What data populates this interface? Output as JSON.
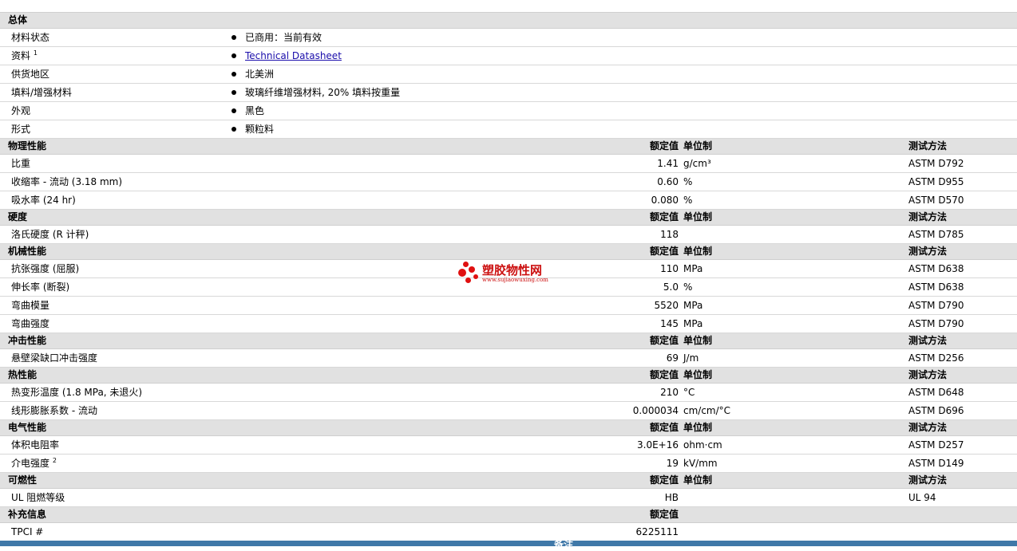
{
  "general": {
    "title": "总体",
    "rows": [
      {
        "label": "材料状态",
        "sup": "",
        "value": "已商用：当前有效",
        "link": false
      },
      {
        "label": "资料",
        "sup": "1",
        "value": "Technical Datasheet",
        "link": true
      },
      {
        "label": "供货地区",
        "sup": "",
        "value": "北美洲",
        "link": false
      },
      {
        "label": "填料/增强材料",
        "sup": "",
        "value": "玻璃纤维增强材料, 20% 填料按重量",
        "link": false
      },
      {
        "label": "外观",
        "sup": "",
        "value": "黑色",
        "link": false
      },
      {
        "label": "形式",
        "sup": "",
        "value": "颗粒料",
        "link": false
      }
    ]
  },
  "headers": {
    "nominal": "额定值",
    "unit": "单位制",
    "method": "测试方法"
  },
  "sections": [
    {
      "title": "物理性能",
      "rows": [
        {
          "label": "比重",
          "sup": "",
          "nominal": "1.41",
          "unit": "g/cm³",
          "method": "ASTM D792"
        },
        {
          "label": "收缩率  - 流动  (3.18 mm)",
          "sup": "",
          "nominal": "0.60",
          "unit": "%",
          "method": "ASTM D955"
        },
        {
          "label": "吸水率  (24 hr)",
          "sup": "",
          "nominal": "0.080",
          "unit": "%",
          "method": "ASTM D570"
        }
      ]
    },
    {
      "title": "硬度",
      "rows": [
        {
          "label": "洛氏硬度  (R 计秤)",
          "sup": "",
          "nominal": "118",
          "unit": "",
          "method": "ASTM D785"
        }
      ]
    },
    {
      "title": "机械性能",
      "rows": [
        {
          "label": "抗张强度  (屈服)",
          "sup": "",
          "nominal": "110",
          "unit": "MPa",
          "method": "ASTM D638"
        },
        {
          "label": "伸长率  (断裂)",
          "sup": "",
          "nominal": "5.0",
          "unit": "%",
          "method": "ASTM D638"
        },
        {
          "label": "弯曲模量",
          "sup": "",
          "nominal": "5520",
          "unit": "MPa",
          "method": "ASTM D790"
        },
        {
          "label": "弯曲强度",
          "sup": "",
          "nominal": "145",
          "unit": "MPa",
          "method": "ASTM D790"
        }
      ]
    },
    {
      "title": "冲击性能",
      "rows": [
        {
          "label": "悬壁梁缺口冲击强度",
          "sup": "",
          "nominal": "69",
          "unit": "J/m",
          "method": "ASTM D256"
        }
      ]
    },
    {
      "title": "热性能",
      "rows": [
        {
          "label": "热变形温度  (1.8 MPa, 未退火)",
          "sup": "",
          "nominal": "210",
          "unit": "°C",
          "method": "ASTM D648"
        },
        {
          "label": "线形膨胀系数  - 流动",
          "sup": "",
          "nominal": "0.000034",
          "unit": "cm/cm/°C",
          "method": "ASTM D696"
        }
      ]
    },
    {
      "title": "电气性能",
      "rows": [
        {
          "label": "体积电阻率",
          "sup": "",
          "nominal": "3.0E+16",
          "unit": "ohm·cm",
          "method": "ASTM D257"
        },
        {
          "label": "介电强度",
          "sup": "2",
          "nominal": "19",
          "unit": "kV/mm",
          "method": "ASTM D149"
        }
      ]
    },
    {
      "title": "可燃性",
      "rows": [
        {
          "label": "UL 阻燃等级",
          "sup": "",
          "nominal": "HB",
          "unit": "",
          "method": "UL 94"
        }
      ]
    },
    {
      "title": "补充信息",
      "nominal_only": true,
      "rows": [
        {
          "label": "TPCI #",
          "sup": "",
          "nominal": "6225111",
          "unit": "",
          "method": ""
        }
      ]
    }
  ],
  "footer": {
    "label": "备注"
  },
  "watermark": {
    "name": "塑胶物性网",
    "url": "www.sujiaowuxing.com"
  }
}
